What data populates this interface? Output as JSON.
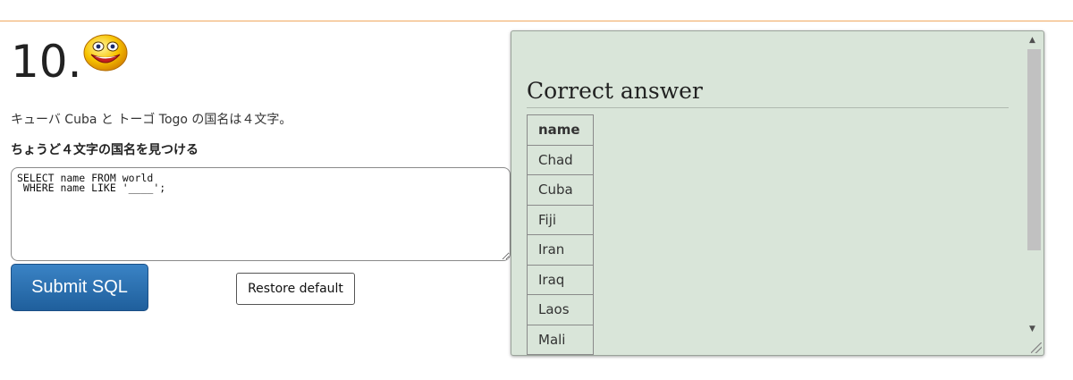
{
  "question": {
    "number": "10.",
    "icon": "smiley-face-icon",
    "description": "キューバ Cuba と トーゴ Togo の国名は４文字。",
    "task": "ちょうど４文字の国名を見つける"
  },
  "editor": {
    "sql": "SELECT name FROM world\n WHERE name LIKE '____';"
  },
  "buttons": {
    "submit_label": "Submit SQL",
    "restore_label": "Restore default"
  },
  "answer": {
    "title": "Correct answer",
    "column_header": "name",
    "rows": [
      "Chad",
      "Cuba",
      "Fiji",
      "Iran",
      "Iraq",
      "Laos",
      "Mali"
    ]
  },
  "colors": {
    "accent_rule": "#f0a860",
    "panel_bg": "#d9e5d9",
    "submit_bg": "#2a6fb0"
  }
}
